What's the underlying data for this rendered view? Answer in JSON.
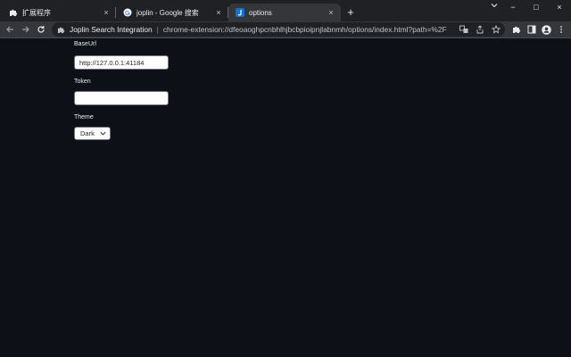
{
  "browser": {
    "tabs": [
      {
        "title": "扩展程序",
        "icon": "puzzle-icon"
      },
      {
        "title": "joplin - Google 搜索",
        "icon": "google-icon"
      },
      {
        "title": "options",
        "icon": "joplin-icon"
      }
    ],
    "active_tab": 2,
    "new_tab_label": "+",
    "window_controls": {
      "minimize": "−",
      "maximize": "□",
      "close": "×"
    },
    "address_bar": {
      "extension_name": "Joplin Search Integration",
      "separator": "|",
      "url": "chrome-extension://dfeoaoghpcnbhlhjbcbpioipnjlabnmh/options/index.html?path=%2F"
    }
  },
  "options": {
    "baseurl_label": "BaseUrl",
    "baseurl_value": "http://127.0.0.1:41184",
    "token_label": "Token",
    "token_value": "",
    "theme_label": "Theme",
    "theme_value": "Dark"
  },
  "colors": {
    "page_background": "#0d1117",
    "tabstrip": "#202124",
    "toolbar": "#35363a",
    "text": "#e6edf3",
    "joplin_blue": "#1071d3"
  }
}
